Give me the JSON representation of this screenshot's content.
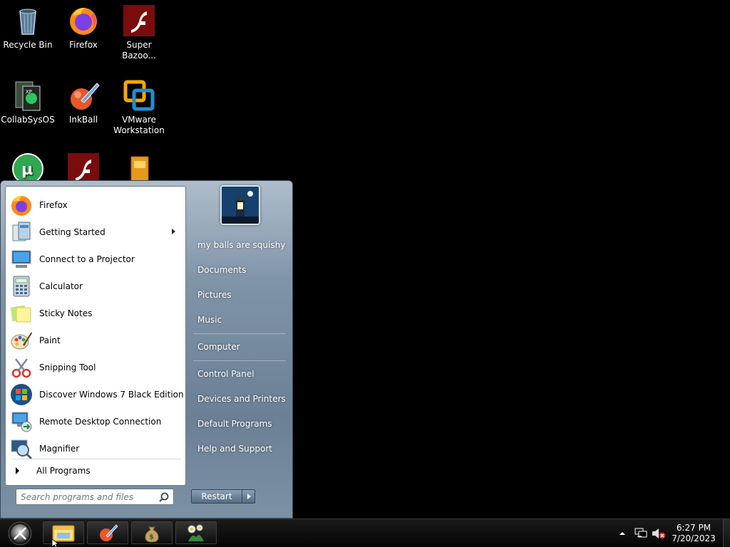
{
  "desktop": {
    "icons": [
      {
        "label": "Recycle Bin",
        "icon": "recycle-bin-icon"
      },
      {
        "label": "Firefox",
        "icon": "firefox-icon"
      },
      {
        "label": "Super Bazoo...",
        "icon": "flash-icon"
      },
      {
        "label": "CollabSysOS",
        "icon": "collabsysos-icon"
      },
      {
        "label": "InkBall",
        "icon": "inkball-icon"
      },
      {
        "label": "VMware Workstation",
        "icon": "vmware-icon"
      },
      {
        "label": "",
        "icon": "utorrent-icon"
      },
      {
        "label": "",
        "icon": "flash-icon"
      },
      {
        "label": "",
        "icon": "puzzle-icon"
      }
    ]
  },
  "start_menu": {
    "programs": [
      {
        "label": "Firefox",
        "icon": "firefox-icon",
        "has_submenu": false
      },
      {
        "label": "Getting Started",
        "icon": "getting-started-icon",
        "has_submenu": true
      },
      {
        "label": "Connect to a Projector",
        "icon": "projector-icon",
        "has_submenu": false
      },
      {
        "label": "Calculator",
        "icon": "calculator-icon",
        "has_submenu": false
      },
      {
        "label": "Sticky Notes",
        "icon": "sticky-notes-icon",
        "has_submenu": false
      },
      {
        "label": "Paint",
        "icon": "paint-icon",
        "has_submenu": false
      },
      {
        "label": "Snipping Tool",
        "icon": "scissors-icon",
        "has_submenu": false
      },
      {
        "label": "Discover Windows 7 Black Edition",
        "icon": "windows-logo-icon",
        "has_submenu": false
      },
      {
        "label": "Remote Desktop Connection",
        "icon": "remote-desktop-icon",
        "has_submenu": false
      },
      {
        "label": "Magnifier",
        "icon": "magnifier-icon",
        "has_submenu": false
      }
    ],
    "all_programs": "All Programs",
    "search_placeholder": "Search programs and files",
    "right_items": [
      "my balls are squishy",
      "Documents",
      "Pictures",
      "Music",
      "Computer",
      "Control Panel",
      "Devices and Printers",
      "Default Programs",
      "Help and Support"
    ],
    "restart_label": "Restart"
  },
  "taskbar": {
    "pinned": [
      "explorer-icon",
      "inkball-icon",
      "money-bag-icon",
      "flowers-icon"
    ],
    "clock_time": "6:27 PM",
    "clock_date": "7/20/2023"
  }
}
